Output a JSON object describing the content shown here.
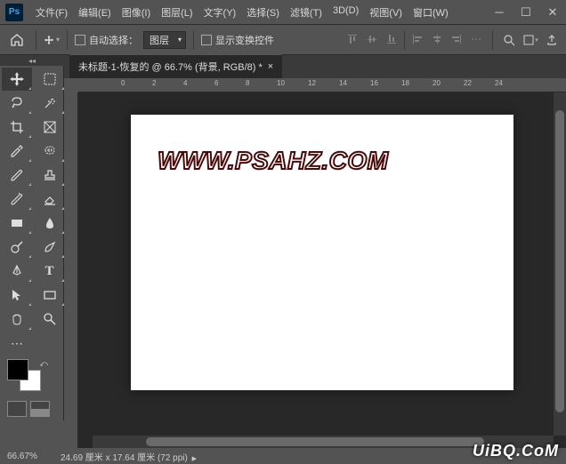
{
  "menu": {
    "file": "文件(F)",
    "edit": "编辑(E)",
    "image": "图像(I)",
    "layer": "图层(L)",
    "type": "文字(Y)",
    "select": "选择(S)",
    "filter": "滤镜(T)",
    "threed": "3D(D)",
    "view": "视图(V)",
    "window": "窗口(W)"
  },
  "options": {
    "auto_select_label": "自动选择：",
    "target_dropdown": "图层",
    "show_transform_label": "显示变换控件"
  },
  "tab": {
    "title": "未标题-1-恢复的 @ 66.7% (背景, RGB/8) *"
  },
  "ruler": {
    "ticks": [
      "0",
      "2",
      "4",
      "6",
      "8",
      "10",
      "12",
      "14",
      "16",
      "18",
      "20",
      "22",
      "24"
    ]
  },
  "canvas_text": "WWW.PSAHZ.COM",
  "status": {
    "zoom": "66.67%",
    "dimensions": "24.69 厘米 x 17.64 厘米 (72 ppi)"
  },
  "watermark": "UiBQ.CoM",
  "icons": {
    "move": "move",
    "marquee": "marquee",
    "lasso": "lasso",
    "wand": "wand",
    "crop": "crop",
    "frame": "frame",
    "eyedropper": "eyedropper",
    "patch": "patch",
    "brush": "brush",
    "stamp": "stamp",
    "history": "history-brush",
    "eraser": "eraser",
    "rect": "rectangle",
    "blur": "blur",
    "dodge": "dodge",
    "smudge": "smudge",
    "zoom-tool": "zoom",
    "pen": "pen",
    "type": "type",
    "path": "path-select",
    "shape": "shape-rect",
    "hand": "hand",
    "search": "magnifier",
    "more": "more"
  },
  "swatch": {
    "fg": "#000000",
    "bg": "#ffffff"
  }
}
